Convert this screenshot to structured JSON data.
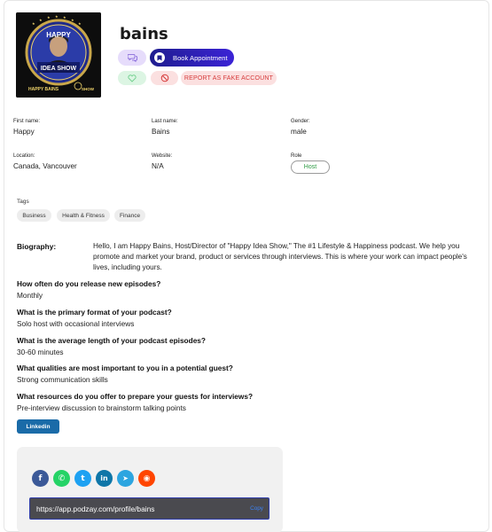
{
  "profile": {
    "username": "bains",
    "avatar_text": {
      "top": "HAPPY",
      "middle": "IDEA SHOW",
      "bottom_left": "HAPPY BAINS",
      "bottom_right": "SHOW"
    }
  },
  "actions": {
    "message_icon": "chat-bubbles-icon",
    "book_label": "Book Appointment",
    "book_icon": "bookmark-icon",
    "favorite_icon": "heart-icon",
    "block_icon": "block-icon",
    "report_label": "REPORT AS FAKE ACCOUNT"
  },
  "fields": {
    "first_name": {
      "label": "First name:",
      "value": "Happy"
    },
    "last_name": {
      "label": "Last name:",
      "value": "Bains"
    },
    "gender": {
      "label": "Gender:",
      "value": "male"
    },
    "location": {
      "label": "Location:",
      "value": "Canada, Vancouver"
    },
    "website": {
      "label": "Website:",
      "value": "N/A"
    },
    "role": {
      "label": "Role",
      "value": "Host"
    }
  },
  "tags": {
    "label": "Tags",
    "items": [
      "Business",
      "Health & Fitness",
      "Finance"
    ]
  },
  "biography": {
    "label": "Biography:",
    "text": "Hello, I am Happy Bains, Host/Director of \"Happy Idea Show,\" The #1 Lifestyle & Happiness podcast. We help you promote and market your brand, product or services through interviews. This is where your work can impact people's lives, including yours."
  },
  "qa": [
    {
      "q": "How often do you release new episodes?",
      "a": "Monthly"
    },
    {
      "q": "What is the primary format of your podcast?",
      "a": "Solo host with occasional interviews"
    },
    {
      "q": "What is the average length of your podcast episodes?",
      "a": "30-60 minutes"
    },
    {
      "q": "What qualities are most important to you in a potential guest?",
      "a": "Strong communication skills"
    },
    {
      "q": "What resources do you offer to prepare your guests for interviews?",
      "a": "Pre-interview discussion to brainstorm talking points"
    }
  ],
  "linkedin_label": "Linkedin",
  "share": {
    "icons": [
      {
        "name": "facebook-icon",
        "glyph": "f",
        "color": "#3b5998"
      },
      {
        "name": "whatsapp-icon",
        "glyph": "✆",
        "color": "#25d366"
      },
      {
        "name": "twitter-icon",
        "glyph": "t",
        "color": "#1da1f2"
      },
      {
        "name": "linkedin-icon",
        "glyph": "in",
        "color": "#0e76a8"
      },
      {
        "name": "telegram-icon",
        "glyph": "➤",
        "color": "#2ca5e0"
      },
      {
        "name": "reddit-icon",
        "glyph": "◉",
        "color": "#ff4500"
      }
    ],
    "url": "https://app.podzay.com/profile/bains",
    "copy_label": "Copy"
  },
  "colors": {
    "accent": "#3b23d6",
    "danger": "#d63b3b",
    "success": "#2e9b44",
    "linkedin": "#1a6ba8"
  }
}
